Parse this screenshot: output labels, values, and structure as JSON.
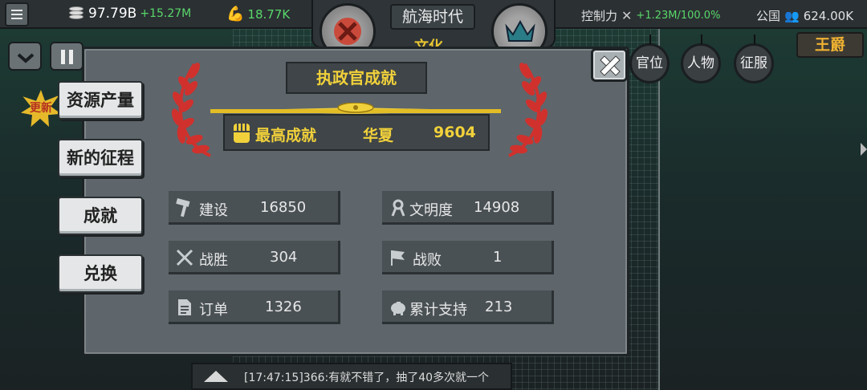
{
  "topbar": {
    "coins_value": "97.79B",
    "coins_delta": "+15.27M",
    "strength_value": "18.77K",
    "hub_title": "航海时代",
    "hub_sub": "文化",
    "control_label": "控制力",
    "control_delta": "+1.23M",
    "control_pct": "/100.0%",
    "nation_label": "公国",
    "population": "624.00K",
    "rank_tab": "王爵"
  },
  "round_buttons": [
    "官位",
    "人物",
    "征服"
  ],
  "side_burst": "更新",
  "side_tabs": [
    "资源产量",
    "新的征程",
    "成就",
    "兑换"
  ],
  "modal": {
    "title": "执政官成就",
    "best_label": "最高成就",
    "best_civ": "华夏",
    "best_value": "9604",
    "stats": [
      {
        "icon": "hammer-icon",
        "label": "建设",
        "value": "16850"
      },
      {
        "icon": "ribbon-icon",
        "label": "文明度",
        "value": "14908"
      },
      {
        "icon": "crossed-swords-icon",
        "label": "战胜",
        "value": "304"
      },
      {
        "icon": "flag-icon",
        "label": "战败",
        "value": "1"
      },
      {
        "icon": "document-icon",
        "label": "订单",
        "value": "1326"
      },
      {
        "icon": "piggy-bank-icon",
        "label": "累计支持",
        "value": "213"
      }
    ]
  },
  "chat": {
    "message": "[17:47:15]366:有就不错了，抽了40多次就一个"
  },
  "colors": {
    "gold": "#f1d13b",
    "positive": "#59d86a",
    "wreath_red": "#d0312d",
    "panel": "#5e666b"
  }
}
